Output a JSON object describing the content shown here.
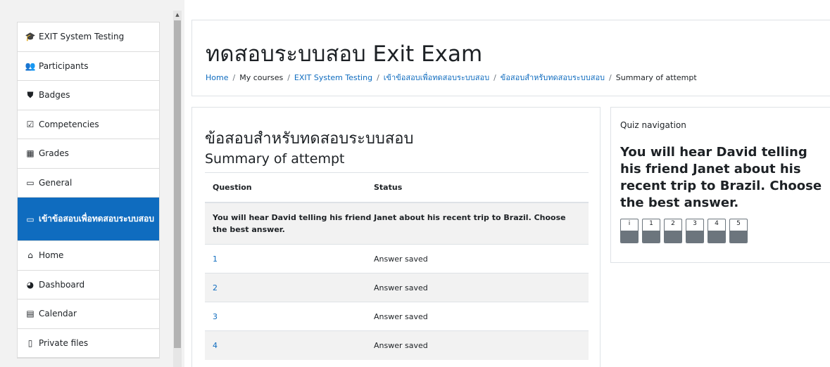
{
  "sidebar": {
    "items": [
      {
        "label": "EXIT System Testing",
        "icon": "graduation-cap-icon",
        "glyph": "🎓"
      },
      {
        "label": "Participants",
        "icon": "users-icon",
        "glyph": "👥"
      },
      {
        "label": "Badges",
        "icon": "shield-icon",
        "glyph": "⛊"
      },
      {
        "label": "Competencies",
        "icon": "check-square-icon",
        "glyph": "☑"
      },
      {
        "label": "Grades",
        "icon": "table-icon",
        "glyph": "▦"
      },
      {
        "label": "General",
        "icon": "folder-icon",
        "glyph": "▭"
      },
      {
        "label": "เข้าข้อสอบเพื่อทดสอบระบบสอบ",
        "icon": "folder-icon",
        "glyph": "▭"
      },
      {
        "label": "Home",
        "icon": "home-icon",
        "glyph": "⌂"
      },
      {
        "label": "Dashboard",
        "icon": "dashboard-icon",
        "glyph": "◕"
      },
      {
        "label": "Calendar",
        "icon": "calendar-icon",
        "glyph": "▤"
      },
      {
        "label": "Private files",
        "icon": "file-icon",
        "glyph": "▯"
      }
    ]
  },
  "header": {
    "title": "ทดสอบระบบสอบ Exit Exam",
    "breadcrumb": [
      "Home",
      "My courses",
      "EXIT System Testing",
      "เข้าข้อสอบเพื่อทดสอบระบบสอบ",
      "ข้อสอบสำหรับทดสอบระบบสอบ",
      "Summary of attempt"
    ]
  },
  "main": {
    "quiz_title": "ข้อสอบสำหรับทดสอบระบบสอบ",
    "summary_title": "Summary of attempt",
    "columns": [
      "Question",
      "Status"
    ],
    "section_text": "You will hear David telling his friend Janet about his recent trip to Brazil. Choose the best answer.",
    "rows": [
      {
        "question": "1",
        "status": "Answer saved"
      },
      {
        "question": "2",
        "status": "Answer saved"
      },
      {
        "question": "3",
        "status": "Answer saved"
      },
      {
        "question": "4",
        "status": "Answer saved"
      }
    ]
  },
  "quiz_nav": {
    "heading": "Quiz navigation",
    "section_text": "You will hear David telling his friend Janet about his recent trip to Brazil. Choose the best answer.",
    "buttons": [
      "i",
      "1",
      "2",
      "3",
      "4",
      "5"
    ]
  },
  "colors": {
    "accent": "#0f6cbf",
    "answered_fill": "#6c757d"
  }
}
